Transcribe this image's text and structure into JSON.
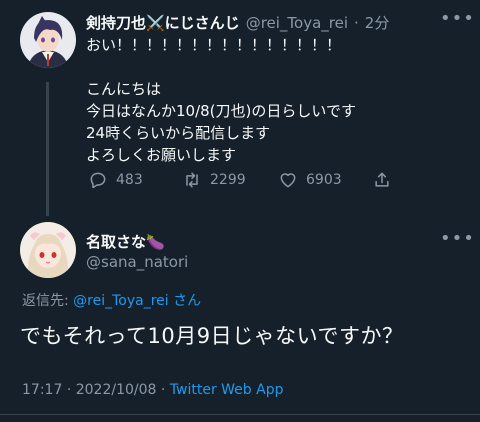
{
  "tweet1": {
    "name": "剣持刀也⚔️にじさんじ",
    "handle": "@rei_Toya_rei",
    "separator": "·",
    "time": "2分",
    "lines": [
      "おい！！！！！！！！！！！！！！！",
      "",
      "こんにちは",
      "今日はなんか10/8(刀也)の日らしいです",
      "24時くらいから配信します",
      "よろしくお願いします"
    ],
    "replies": "483",
    "retweets": "2299",
    "likes": "6903"
  },
  "tweet2": {
    "name": "名取さな🍆",
    "handle": "@sana_natori",
    "reply_prefix": "返信先: ",
    "reply_to": "@rei_Toya_rei",
    "reply_suffix": " さん",
    "text": "でもそれって10月9日じゃないですか？",
    "time": "17:17",
    "date": "2022/10/08",
    "separator": "·",
    "app": "Twitter Web App"
  },
  "icons": {
    "reply": "reply-icon",
    "retweet": "retweet-icon",
    "like": "heart-icon",
    "share": "share-icon",
    "more": "more-icon"
  },
  "colors": {
    "background": "#15202b",
    "text": "#f7f9f9",
    "secondary": "#8b98a5",
    "link": "#1d9bf0"
  }
}
